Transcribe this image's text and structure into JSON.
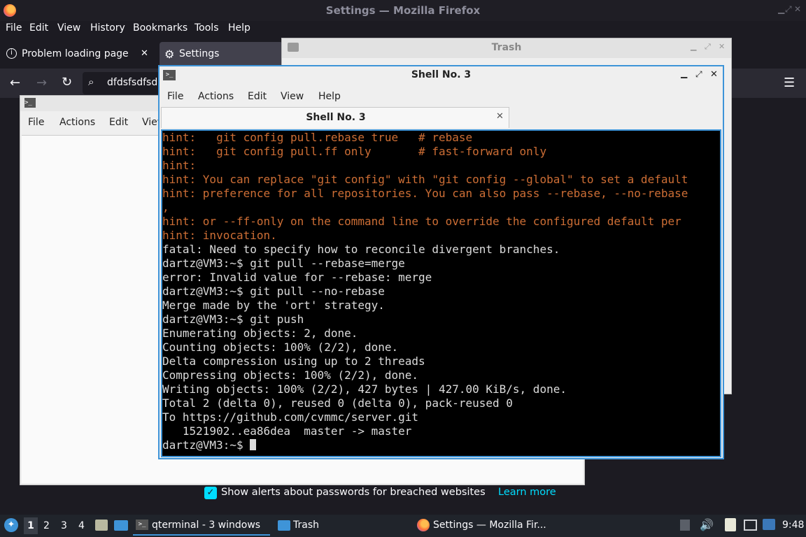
{
  "firefox": {
    "window_title": "Settings — Mozilla Firefox",
    "menu": [
      "File",
      "Edit",
      "View",
      "History",
      "Bookmarks",
      "Tools",
      "Help"
    ],
    "tabs": [
      {
        "label": "Problem loading page"
      },
      {
        "label": "Settings"
      }
    ],
    "url_text": "dfdsfsdfsd",
    "breach_label": "Show alerts about passwords for breached websites",
    "learn_more": "Learn more"
  },
  "trash": {
    "title": "Trash"
  },
  "qterminal_bg": {
    "menu": [
      "File",
      "Actions",
      "Edit",
      "View"
    ]
  },
  "shell": {
    "title": "Shell No. 3",
    "menu": [
      "File",
      "Actions",
      "Edit",
      "View",
      "Help"
    ],
    "tab_label": "Shell No. 3",
    "lines": [
      {
        "text": "hint:   git config pull.rebase true   # rebase",
        "kind": "hint"
      },
      {
        "text": "hint:   git config pull.ff only       # fast-forward only",
        "kind": "hint"
      },
      {
        "text": "hint:",
        "kind": "hint"
      },
      {
        "text": "hint: You can replace \"git config\" with \"git config --global\" to set a default",
        "kind": "hint"
      },
      {
        "text": "hint: preference for all repositories. You can also pass --rebase, --no-rebase",
        "kind": "hint"
      },
      {
        "text": ",",
        "kind": "hint"
      },
      {
        "text": "hint: or --ff-only on the command line to override the configured default per",
        "kind": "hint"
      },
      {
        "text": "hint: invocation.",
        "kind": "hint"
      },
      {
        "text": "fatal: Need to specify how to reconcile divergent branches.",
        "kind": "norm"
      },
      {
        "text": "dartz@VM3:~$ git pull --rebase=merge",
        "kind": "norm"
      },
      {
        "text": "error: Invalid value for --rebase: merge",
        "kind": "norm"
      },
      {
        "text": "dartz@VM3:~$ git pull --no-rebase",
        "kind": "norm"
      },
      {
        "text": "Merge made by the 'ort' strategy.",
        "kind": "norm"
      },
      {
        "text": "dartz@VM3:~$ git push",
        "kind": "norm"
      },
      {
        "text": "Enumerating objects: 2, done.",
        "kind": "norm"
      },
      {
        "text": "Counting objects: 100% (2/2), done.",
        "kind": "norm"
      },
      {
        "text": "Delta compression using up to 2 threads",
        "kind": "norm"
      },
      {
        "text": "Compressing objects: 100% (2/2), done.",
        "kind": "norm"
      },
      {
        "text": "Writing objects: 100% (2/2), 427 bytes | 427.00 KiB/s, done.",
        "kind": "norm"
      },
      {
        "text": "Total 2 (delta 0), reused 0 (delta 0), pack-reused 0",
        "kind": "norm"
      },
      {
        "text": "To https://github.com/cvmmc/server.git",
        "kind": "norm"
      },
      {
        "text": "   1521902..ea86dea  master -> master",
        "kind": "norm"
      }
    ],
    "prompt": "dartz@VM3:~$ "
  },
  "taskbar": {
    "workspaces": [
      "1",
      "2",
      "3",
      "4"
    ],
    "items": [
      {
        "label": "qterminal - 3 windows"
      },
      {
        "label": "Trash"
      },
      {
        "label": "Settings — Mozilla Fir..."
      }
    ],
    "clock": "9:48"
  },
  "colors": {
    "accent": "#3e94d8",
    "hint_text": "#cd6e35",
    "link": "#00ddff"
  }
}
